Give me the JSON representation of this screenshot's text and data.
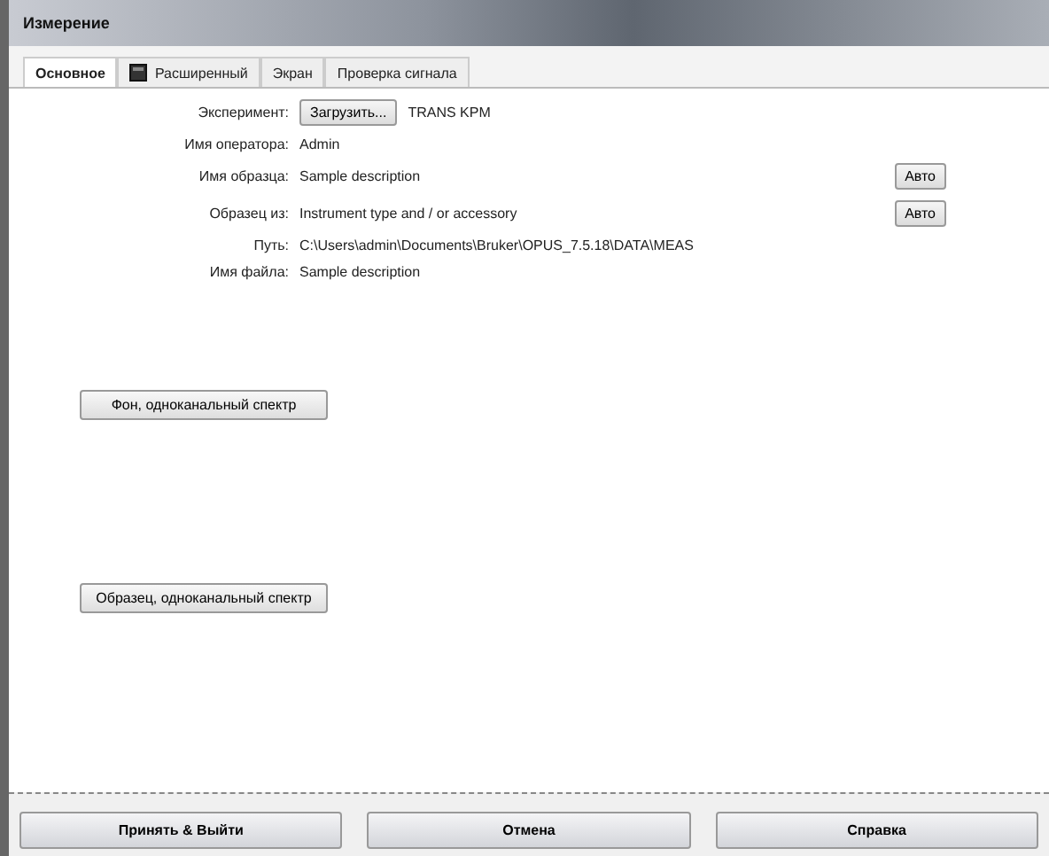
{
  "window": {
    "title": "Измерение"
  },
  "tabs": [
    {
      "label": "Основное",
      "selected": true,
      "icon": false
    },
    {
      "label": "Расширенный",
      "selected": false,
      "icon": true
    },
    {
      "label": "Экран",
      "selected": false,
      "icon": false
    },
    {
      "label": "Проверка сигнала",
      "selected": false,
      "icon": false
    }
  ],
  "fields": [
    {
      "label": "Эксперимент:",
      "kind": "load",
      "button": "Загрузить...",
      "value": "TRANS KPM"
    },
    {
      "label": "Имя оператора:",
      "kind": "text",
      "value": "Admin"
    },
    {
      "label": "Имя образца:",
      "kind": "auto",
      "value": "Sample description",
      "button": "Авто"
    },
    {
      "label": "Образец из:",
      "kind": "auto",
      "value": "Instrument type and / or accessory",
      "button": "Авто"
    },
    {
      "label": "Путь:",
      "kind": "text",
      "value": "C:\\Users\\admin\\Documents\\Bruker\\OPUS_7.5.18\\DATA\\MEAS"
    },
    {
      "label": "Имя файла:",
      "kind": "text",
      "value": "Sample description"
    }
  ],
  "measure_buttons": [
    "Фон, одноканальный спектр",
    "Образец, одноканальный спектр"
  ],
  "footer_buttons": [
    "Принять & Выйти",
    "Отмена",
    "Справка"
  ]
}
